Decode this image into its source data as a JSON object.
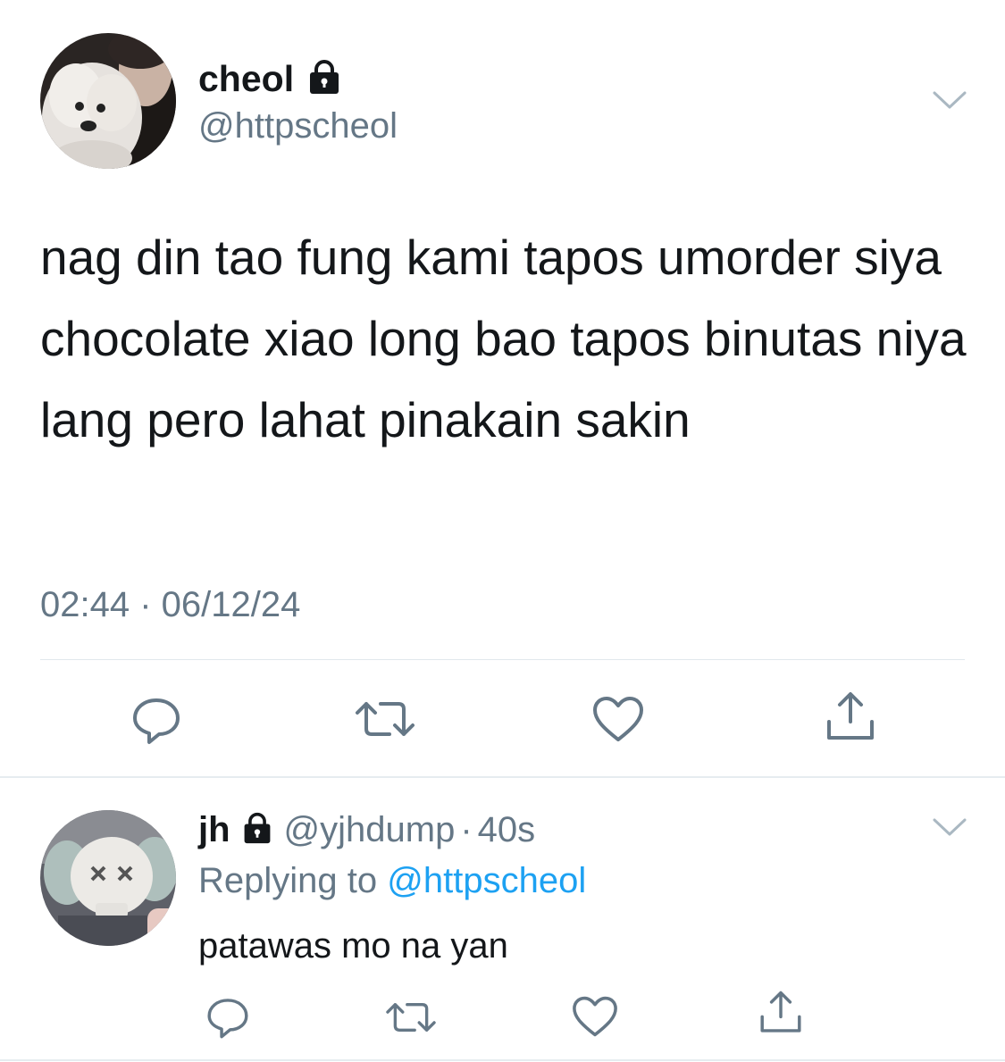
{
  "main_tweet": {
    "display_name": "cheol",
    "handle": "@httpscheol",
    "text": "nag din tao fung kami tapos umorder siya chocolate xiao long bao tapos binutas niya lang pero lahat pinakain sakin",
    "timestamp": "02:44 · 06/12/24",
    "protected_icon": "lock-icon",
    "menu_icon": "chevron-down-icon",
    "actions": [
      "reply-icon",
      "retweet-icon",
      "like-icon",
      "share-icon"
    ]
  },
  "reply_tweet": {
    "display_name": "jh",
    "handle": "@yjhdump",
    "separator": "·",
    "time_ago": "40s",
    "replying_prefix": "Replying to",
    "replying_to": "@httpscheol",
    "text": "patawas mo na yan",
    "protected_icon": "lock-icon",
    "menu_icon": "chevron-down-icon",
    "actions": [
      "reply-icon",
      "retweet-icon",
      "like-icon",
      "share-icon"
    ]
  },
  "colors": {
    "text": "#14171a",
    "secondary": "#657786",
    "link": "#1da1f2",
    "divider": "#e1e8ed"
  }
}
